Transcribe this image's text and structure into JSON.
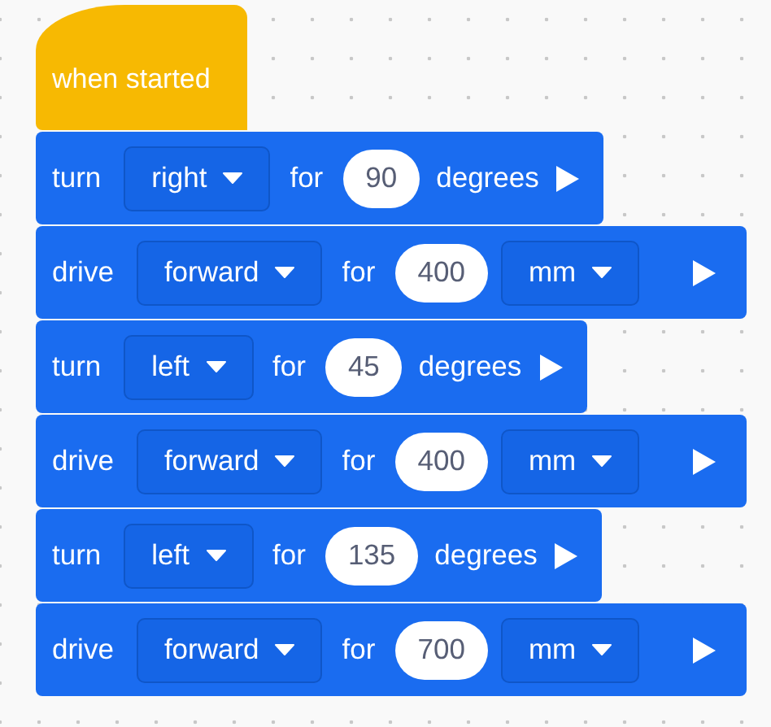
{
  "hat_block": {
    "label": "when started"
  },
  "blocks": [
    {
      "kind": "turn",
      "verb": "turn",
      "direction": "right",
      "connector": "for",
      "value": "90",
      "unit": "degrees"
    },
    {
      "kind": "drive",
      "verb": "drive",
      "direction": "forward",
      "connector": "for",
      "value": "400",
      "unit": "mm"
    },
    {
      "kind": "turn",
      "verb": "turn",
      "direction": "left",
      "connector": "for",
      "value": "45",
      "unit": "degrees"
    },
    {
      "kind": "drive",
      "verb": "drive",
      "direction": "forward",
      "connector": "for",
      "value": "400",
      "unit": "mm"
    },
    {
      "kind": "turn",
      "verb": "turn",
      "direction": "left",
      "connector": "for",
      "value": "135",
      "unit": "degrees"
    },
    {
      "kind": "drive",
      "verb": "drive",
      "direction": "forward",
      "connector": "for",
      "value": "700",
      "unit": "mm"
    }
  ]
}
